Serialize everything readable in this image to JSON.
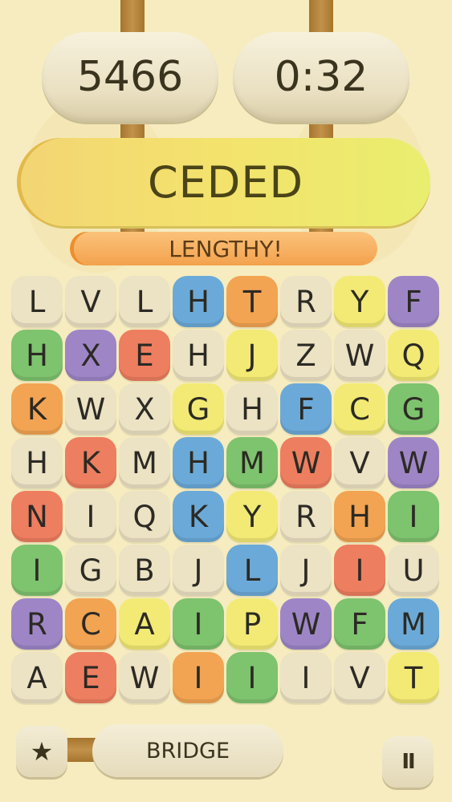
{
  "header": {
    "score": "5466",
    "timer": "0:32"
  },
  "current_word": "CEDED",
  "feedback": "LENGTHY!",
  "board": {
    "rows": [
      [
        {
          "l": "L",
          "c": "cream"
        },
        {
          "l": "V",
          "c": "cream"
        },
        {
          "l": "L",
          "c": "cream"
        },
        {
          "l": "H",
          "c": "blue"
        },
        {
          "l": "T",
          "c": "orange"
        },
        {
          "l": "R",
          "c": "cream"
        },
        {
          "l": "Y",
          "c": "yellow"
        },
        {
          "l": "F",
          "c": "purple"
        }
      ],
      [
        {
          "l": "H",
          "c": "green"
        },
        {
          "l": "X",
          "c": "purple"
        },
        {
          "l": "E",
          "c": "red"
        },
        {
          "l": "H",
          "c": "cream"
        },
        {
          "l": "J",
          "c": "yellow"
        },
        {
          "l": "Z",
          "c": "cream"
        },
        {
          "l": "W",
          "c": "cream"
        },
        {
          "l": "Q",
          "c": "yellow"
        }
      ],
      [
        {
          "l": "K",
          "c": "orange"
        },
        {
          "l": "W",
          "c": "cream"
        },
        {
          "l": "X",
          "c": "cream"
        },
        {
          "l": "G",
          "c": "yellow"
        },
        {
          "l": "H",
          "c": "cream"
        },
        {
          "l": "F",
          "c": "blue"
        },
        {
          "l": "C",
          "c": "yellow"
        },
        {
          "l": "G",
          "c": "green"
        }
      ],
      [
        {
          "l": "H",
          "c": "cream"
        },
        {
          "l": "K",
          "c": "red"
        },
        {
          "l": "M",
          "c": "cream"
        },
        {
          "l": "H",
          "c": "blue"
        },
        {
          "l": "M",
          "c": "green"
        },
        {
          "l": "W",
          "c": "red"
        },
        {
          "l": "V",
          "c": "cream"
        },
        {
          "l": "W",
          "c": "purple"
        }
      ],
      [
        {
          "l": "N",
          "c": "red"
        },
        {
          "l": "I",
          "c": "cream"
        },
        {
          "l": "Q",
          "c": "cream"
        },
        {
          "l": "K",
          "c": "blue"
        },
        {
          "l": "Y",
          "c": "yellow"
        },
        {
          "l": "R",
          "c": "cream"
        },
        {
          "l": "H",
          "c": "orange"
        },
        {
          "l": "I",
          "c": "green"
        }
      ],
      [
        {
          "l": "I",
          "c": "green"
        },
        {
          "l": "G",
          "c": "cream"
        },
        {
          "l": "B",
          "c": "cream"
        },
        {
          "l": "J",
          "c": "cream"
        },
        {
          "l": "L",
          "c": "blue"
        },
        {
          "l": "J",
          "c": "cream"
        },
        {
          "l": "I",
          "c": "red"
        },
        {
          "l": "U",
          "c": "cream"
        }
      ],
      [
        {
          "l": "R",
          "c": "purple"
        },
        {
          "l": "C",
          "c": "orange"
        },
        {
          "l": "A",
          "c": "yellow"
        },
        {
          "l": "I",
          "c": "green"
        },
        {
          "l": "P",
          "c": "yellow"
        },
        {
          "l": "W",
          "c": "purple"
        },
        {
          "l": "F",
          "c": "green"
        },
        {
          "l": "M",
          "c": "blue"
        }
      ],
      [
        {
          "l": "A",
          "c": "cream"
        },
        {
          "l": "E",
          "c": "red"
        },
        {
          "l": "W",
          "c": "cream"
        },
        {
          "l": "I",
          "c": "orange"
        },
        {
          "l": "I",
          "c": "green"
        },
        {
          "l": "I",
          "c": "cream"
        },
        {
          "l": "V",
          "c": "cream"
        },
        {
          "l": "T",
          "c": "yellow"
        }
      ]
    ]
  },
  "footer": {
    "bonus_word": "BRIDGE",
    "star_icon": "★",
    "pause_icon": "II"
  },
  "colors": {
    "background": "#f6ecbf",
    "word_bar": "#f3e36c",
    "feedback_banner": "#f3a24d"
  }
}
